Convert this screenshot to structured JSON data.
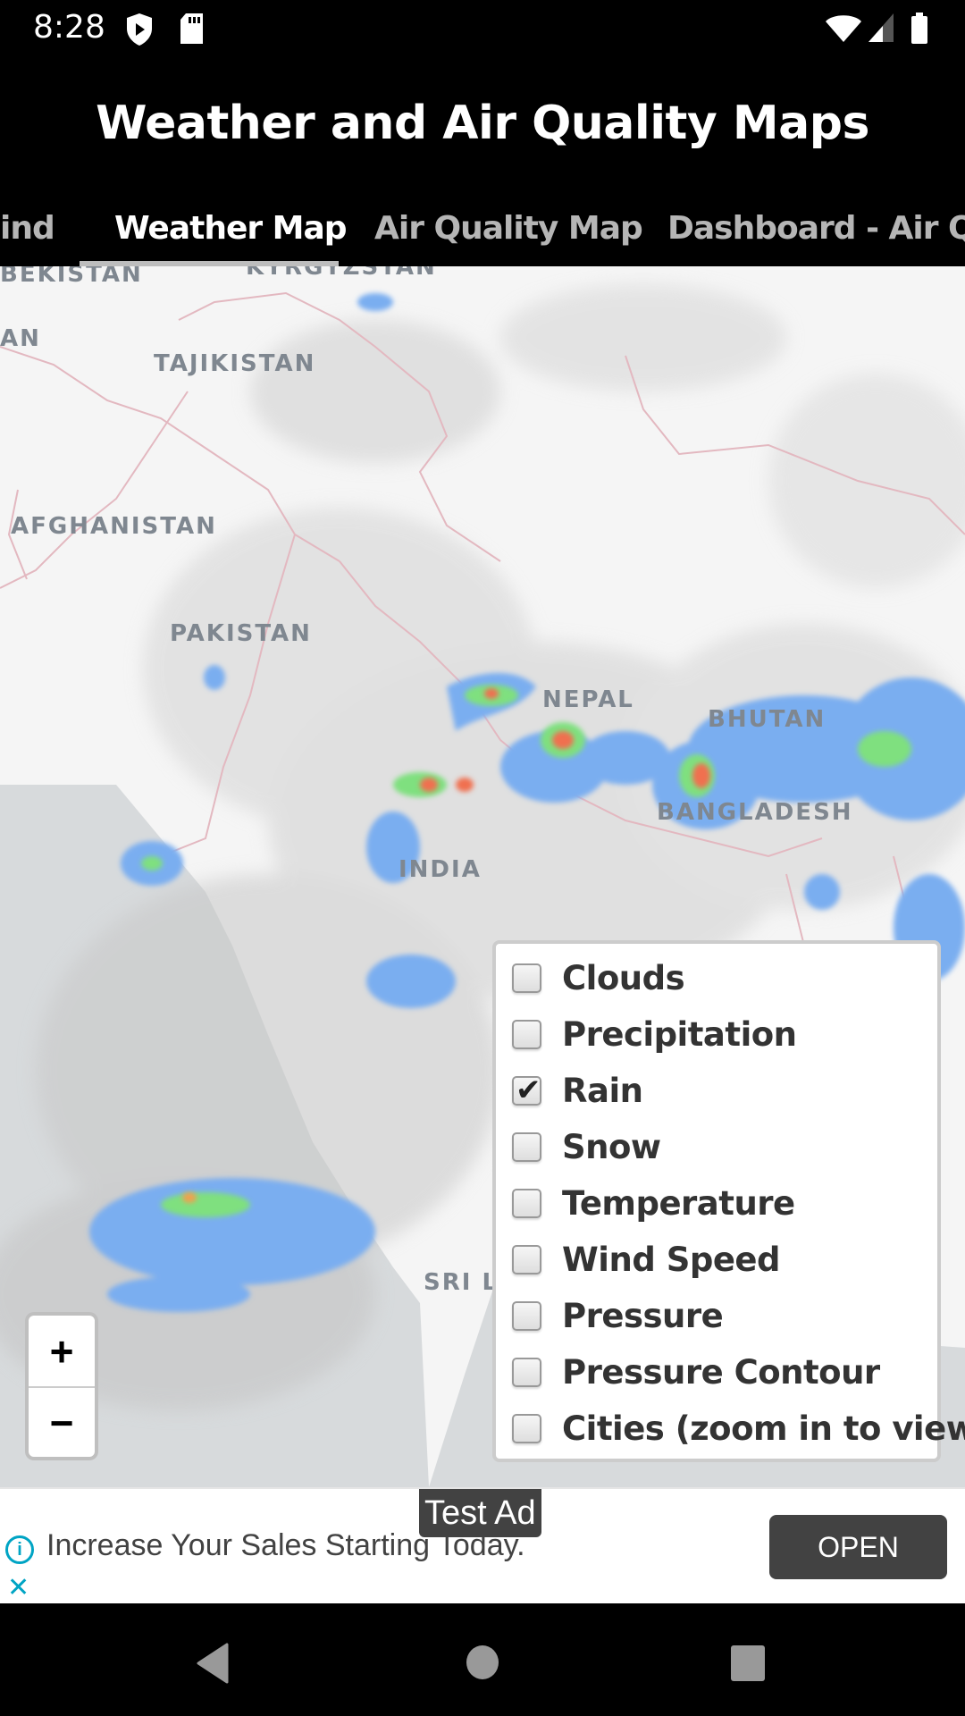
{
  "status_bar": {
    "time": "8:28",
    "left_icons": [
      "shield-play-icon",
      "sd-card-icon"
    ],
    "right_icons": [
      "wifi-icon",
      "cell-signal-icon",
      "battery-icon"
    ]
  },
  "app": {
    "title": "Weather and Air Quality Maps"
  },
  "tabs": [
    {
      "label": "ind",
      "active": false
    },
    {
      "label": "Weather Map",
      "active": true
    },
    {
      "label": "Air Quality Map",
      "active": false
    },
    {
      "label": "Dashboard - Air Qual",
      "active": false
    }
  ],
  "map": {
    "labels": [
      "BEKISTAN",
      "KYRGYZSTAN",
      "AN",
      "TAJIKISTAN",
      "AFGHANISTAN",
      "PAKISTAN",
      "NEPAL",
      "BHUTAN",
      "BANGLADESH",
      "INDIA",
      "SRI L"
    ],
    "zoom_in_label": "+",
    "zoom_out_label": "−",
    "colors": {
      "land": "#f5f5f5",
      "sea": "#d7dadc",
      "border": "#e3b8c0",
      "rain_light": "#7aaef0",
      "rain_mid": "#7fe07f",
      "rain_heavy": "#f07050"
    }
  },
  "layers": {
    "items": [
      {
        "label": "Clouds",
        "checked": false
      },
      {
        "label": "Precipitation",
        "checked": false
      },
      {
        "label": "Rain",
        "checked": true
      },
      {
        "label": "Snow",
        "checked": false
      },
      {
        "label": "Temperature",
        "checked": false
      },
      {
        "label": "Wind Speed",
        "checked": false
      },
      {
        "label": "Pressure",
        "checked": false
      },
      {
        "label": "Pressure Contour",
        "checked": false
      },
      {
        "label": "Cities (zoom in to view)",
        "checked": false
      }
    ],
    "check_glyph": "✔"
  },
  "ad": {
    "badge": "Test Ad",
    "text": "Increase Your Sales Starting Today.",
    "cta": "OPEN",
    "info_glyph": "i",
    "close_glyph": "✕"
  },
  "nav_bar": {
    "icons": [
      "back-icon",
      "home-icon",
      "recents-icon"
    ]
  }
}
